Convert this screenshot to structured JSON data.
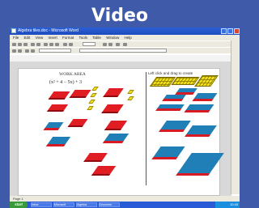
{
  "banner": {
    "title": "Video"
  },
  "window": {
    "title": "Algebra tiles.doc - Microsoft Word",
    "menu": [
      "File",
      "Edit",
      "View",
      "Insert",
      "Format",
      "Tools",
      "Table",
      "Window",
      "Help"
    ],
    "zoom": "100%"
  },
  "document": {
    "work_area_title": "WORK AREA",
    "expression": "(x² + 4 − 5x) + 3",
    "right_label": "Left click and drag to create"
  },
  "status": {
    "page": "Page 1"
  },
  "taskbar": {
    "start_label": "start",
    "items": [
      "Inbox",
      "Microsoft",
      "Algebra",
      "Documen"
    ],
    "clock": "10:45"
  },
  "colors": {
    "red_tile": "#e11d24",
    "blue_tile": "#1f7fb6",
    "yellow_tile": "#f4e21b",
    "banner": "#3f5aa8"
  }
}
